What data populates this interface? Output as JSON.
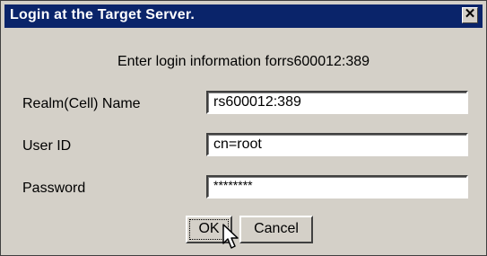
{
  "window": {
    "title": "Login at the Target Server.",
    "close_symbol": "✕"
  },
  "instruction": "Enter login information forrs600012:389",
  "form": {
    "realm": {
      "label": "Realm(Cell) Name",
      "value": "rs600012:389"
    },
    "user_id": {
      "label": "User ID",
      "value": "cn=root"
    },
    "password": {
      "label": "Password",
      "value": "********"
    }
  },
  "buttons": {
    "ok": "OK",
    "cancel": "Cancel"
  },
  "icons": {
    "close": "close-icon",
    "cursor": "mouse-pointer-icon"
  },
  "colors": {
    "titlebar": "#0a246a",
    "dialog_bg": "#d4d0c8"
  }
}
